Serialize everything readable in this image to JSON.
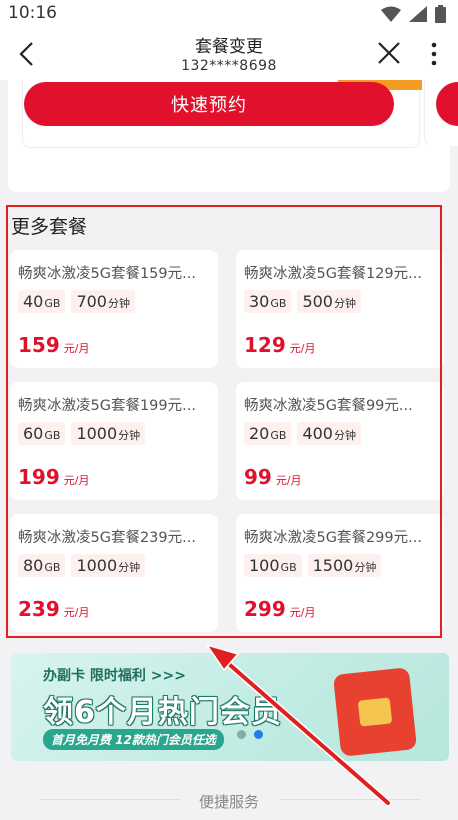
{
  "status_bar": {
    "time": "10:16"
  },
  "nav": {
    "title": "套餐变更",
    "subtitle": "132****8698"
  },
  "top_card": {
    "reserve_label": "快速预约"
  },
  "more_plans": {
    "title": "更多套餐",
    "plans": [
      {
        "name": "畅爽冰激凌5G套餐159元...",
        "data_amount": "40",
        "data_unit": "GB",
        "minutes": "700",
        "minutes_unit": "分钟",
        "price": "159",
        "price_unit": "元/月"
      },
      {
        "name": "畅爽冰激凌5G套餐129元...",
        "data_amount": "30",
        "data_unit": "GB",
        "minutes": "500",
        "minutes_unit": "分钟",
        "price": "129",
        "price_unit": "元/月"
      },
      {
        "name": "畅爽冰激凌5G套餐199元...",
        "data_amount": "60",
        "data_unit": "GB",
        "minutes": "1000",
        "minutes_unit": "分钟",
        "price": "199",
        "price_unit": "元/月"
      },
      {
        "name": "畅爽冰激凌5G套餐99元...",
        "data_amount": "20",
        "data_unit": "GB",
        "minutes": "400",
        "minutes_unit": "分钟",
        "price": "99",
        "price_unit": "元/月"
      },
      {
        "name": "畅爽冰激凌5G套餐239元...",
        "data_amount": "80",
        "data_unit": "GB",
        "minutes": "1000",
        "minutes_unit": "分钟",
        "price": "239",
        "price_unit": "元/月"
      },
      {
        "name": "畅爽冰激凌5G套餐299元...",
        "data_amount": "100",
        "data_unit": "GB",
        "minutes": "1500",
        "minutes_unit": "分钟",
        "price": "299",
        "price_unit": "元/月"
      }
    ]
  },
  "banner": {
    "subtitle": "办副卡 限时福利 >>>",
    "headline": "领6个月热门会员",
    "bottom_text": "首月免月费 12款热门会员任选"
  },
  "footer": {
    "label": "便捷服务"
  },
  "colors": {
    "brand_red": "#e1102d",
    "annotation_red": "#e02020",
    "banner_teal": "#2aa58e"
  }
}
